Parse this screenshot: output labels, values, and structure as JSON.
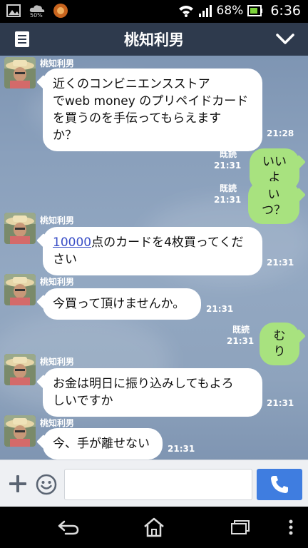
{
  "status_bar": {
    "battery_percent": "68%",
    "time": "6:36",
    "download_badge": "50%"
  },
  "header": {
    "title": "桃知利男"
  },
  "messages": [
    {
      "sender": "桃知利男",
      "lines": [
        "近くのコンビニエンスストア",
        "でweb money のプリペイドカード",
        "を買うのを手伝ってもらえます",
        "か？"
      ],
      "time": "21:28"
    },
    {
      "read": "既読",
      "time": "21:31",
      "text": "いいよ"
    },
    {
      "read": "既読",
      "time": "21:31",
      "text": "いつ？"
    },
    {
      "sender": "桃知利男",
      "link": "10000",
      "line1_rest": "点のカードを4枚買ってくだ",
      "line2": "さい",
      "time": "21:31"
    },
    {
      "sender": "桃知利男",
      "text": "今買って頂けませんか。",
      "time": "21:31"
    },
    {
      "read": "既読",
      "time": "21:31",
      "text": "むり"
    },
    {
      "sender": "桃知利男",
      "lines": [
        "お金は明日に振り込みしてもよろ",
        "しいですか"
      ],
      "time": "21:31"
    },
    {
      "sender": "桃知利男",
      "text": "今、手が離せない",
      "time": "21:31"
    }
  ],
  "input": {
    "value": "",
    "placeholder": ""
  },
  "colors": {
    "header_bg": "#2e3a4d",
    "outgoing_bubble": "#a8e27f",
    "incoming_bubble": "#ffffff",
    "call_button": "#3f7de0"
  }
}
